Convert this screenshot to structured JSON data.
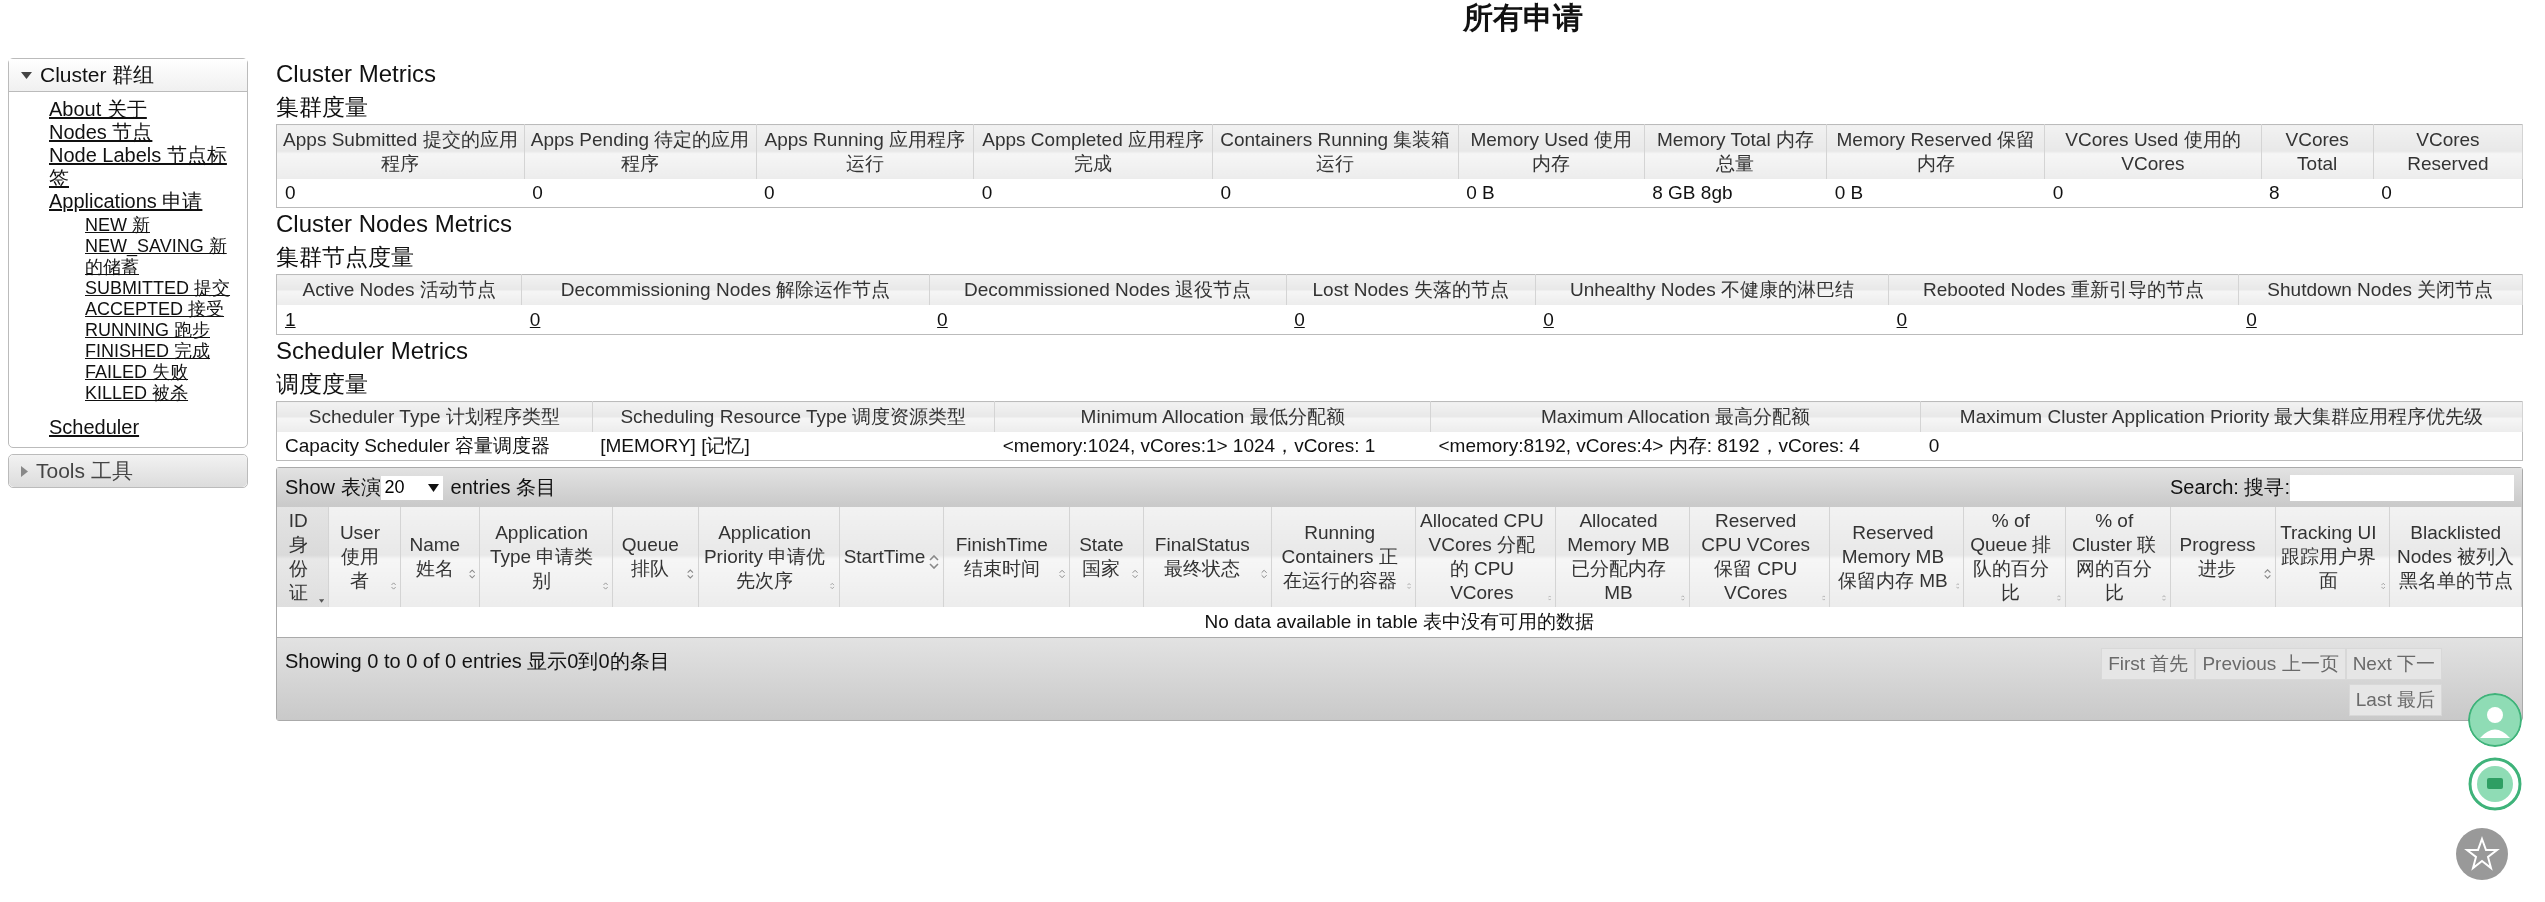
{
  "page_title": "所有申请",
  "sidebar": [
    {
      "label": "Cluster 群组",
      "expanded": true,
      "items": [
        {
          "label": "About 关于"
        },
        {
          "label": "Nodes 节点"
        },
        {
          "label": "Node Labels 节点标签"
        },
        {
          "label": "Applications 申请",
          "children": [
            {
              "label": "NEW 新"
            },
            {
              "label": "NEW_SAVING 新的储蓄"
            },
            {
              "label": "SUBMITTED 提交"
            },
            {
              "label": "ACCEPTED 接受"
            },
            {
              "label": "RUNNING 跑步"
            },
            {
              "label": "FINISHED 完成"
            },
            {
              "label": "FAILED 失败"
            },
            {
              "label": "KILLED 被杀"
            }
          ]
        },
        {
          "label": "Scheduler"
        }
      ]
    },
    {
      "label": "Tools 工具",
      "expanded": false
    }
  ],
  "sections": [
    {
      "title": "Cluster Metrics",
      "subtitle": "集群度量",
      "columns": [
        "Apps Submitted 提交的应用程序",
        "Apps Pending 待定的应用程序",
        "Apps Running 应用程序运行",
        "Apps Completed 应用程序完成",
        "Containers Running 集装箱运行",
        "Memory Used 使用内存",
        "Memory Total 内存总量",
        "Memory Reserved 保留内存",
        "VCores Used 使用的VCores",
        "VCores Total",
        "VCores Reserved"
      ],
      "rows": [
        {
          "link": false,
          "cells": [
            "0",
            "0",
            "0",
            "0",
            "0",
            "0 B",
            "8 GB 8gb",
            "0 B",
            "0",
            "8",
            "0"
          ]
        }
      ]
    },
    {
      "title": "Cluster Nodes Metrics",
      "subtitle": "集群节点度量",
      "columns": [
        "Active Nodes 活动节点",
        "Decommissioning Nodes 解除运作节点",
        "Decommissioned Nodes 退役节点",
        "Lost Nodes 失落的节点",
        "Unhealthy Nodes 不健康的淋巴结",
        "Rebooted Nodes 重新引导的节点",
        "Shutdown Nodes 关闭节点"
      ],
      "rows": [
        {
          "link": true,
          "cells": [
            "1",
            "0",
            "0",
            "0",
            "0",
            "0",
            "0"
          ]
        }
      ]
    },
    {
      "title": "Scheduler Metrics",
      "subtitle": "调度度量",
      "columns": [
        "Scheduler Type 计划程序类型",
        "Scheduling Resource Type 调度资源类型",
        "Minimum Allocation 最低分配额",
        "Maximum Allocation 最高分配额",
        "Maximum Cluster Application Priority 最大集群应用程序优先级"
      ],
      "rows": [
        {
          "link": false,
          "cells": [
            "Capacity Scheduler 容量调度器",
            "[MEMORY] [记忆]",
            "<memory:1024, vCores:1> 1024，vCores: 1",
            "<memory:8192, vCores:4> 内存: 8192，vCores: 4",
            "0"
          ]
        }
      ]
    }
  ],
  "apps_table": {
    "show_label": "Show 表演",
    "page_size": "20",
    "entries_label": "entries 条目",
    "search_label": "Search: 搜寻:",
    "columns": [
      {
        "label": "ID 身份证",
        "sortable": true,
        "sorted": true
      },
      {
        "label": "User 使用者",
        "sortable": true,
        "sorted": false
      },
      {
        "label": "Name 姓名",
        "sortable": true,
        "sorted": false
      },
      {
        "label": "Application Type 申请类别",
        "sortable": true,
        "sorted": false
      },
      {
        "label": "Queue 排队",
        "sortable": true,
        "sorted": false
      },
      {
        "label": "Application Priority 申请优先次序",
        "sortable": true,
        "sorted": false
      },
      {
        "label": "StartTime",
        "sortable": true,
        "sorted": false
      },
      {
        "label": "FinishTime 结束时间",
        "sortable": true,
        "sorted": false
      },
      {
        "label": "State 国家",
        "sortable": true,
        "sorted": false
      },
      {
        "label": "FinalStatus 最终状态",
        "sortable": true,
        "sorted": false
      },
      {
        "label": "Running Containers 正在运行的容器",
        "sortable": true,
        "sorted": false
      },
      {
        "label": "Allocated CPU VCores 分配的 CPU VCores",
        "sortable": true,
        "sorted": false
      },
      {
        "label": "Allocated Memory MB 已分配内存 MB",
        "sortable": true,
        "sorted": false
      },
      {
        "label": "Reserved CPU VCores 保留 CPU VCores",
        "sortable": true,
        "sorted": false
      },
      {
        "label": "Reserved Memory MB 保留内存 MB",
        "sortable": true,
        "sorted": false
      },
      {
        "label": "% of Queue 排队的百分比",
        "sortable": true,
        "sorted": false
      },
      {
        "label": "% of Cluster 联网的百分比",
        "sortable": true,
        "sorted": false
      },
      {
        "label": "Progress 进步",
        "sortable": true,
        "sorted": false
      },
      {
        "label": "Tracking UI 跟踪用户界面",
        "sortable": true,
        "sorted": false
      },
      {
        "label": "Blacklisted Nodes 被列入黑名单的节点",
        "sortable": false,
        "sorted": false
      }
    ],
    "empty_message": "No data available in table 表中没有可用的数据",
    "info": "Showing 0 to 0 of 0 entries 显示0到0的条目",
    "pager": [
      {
        "label": "First 首先",
        "disabled": true
      },
      {
        "label": "Previous 上一页",
        "disabled": true
      },
      {
        "label": "Next 下一",
        "disabled": true
      },
      {
        "label": "Last 最后",
        "disabled": true
      }
    ]
  }
}
